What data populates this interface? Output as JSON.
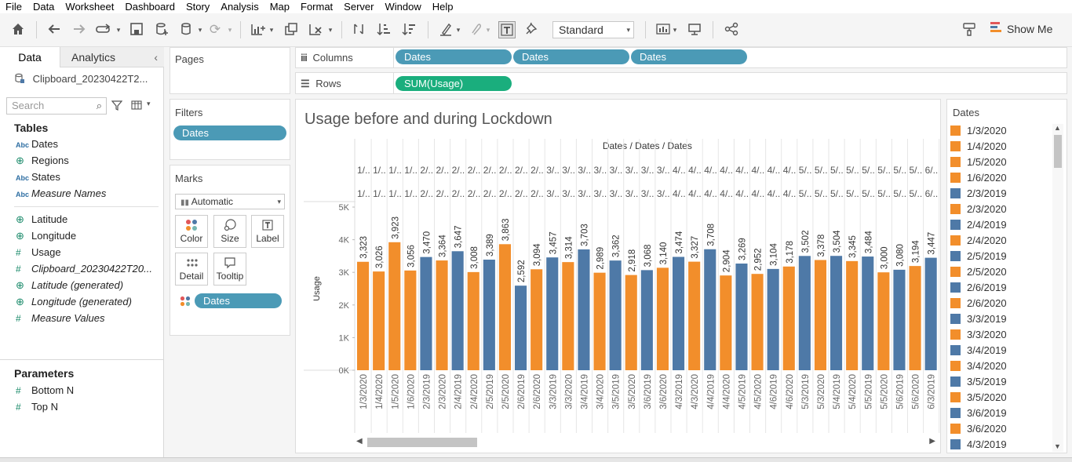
{
  "menu": [
    "File",
    "Data",
    "Worksheet",
    "Dashboard",
    "Story",
    "Analysis",
    "Map",
    "Format",
    "Server",
    "Window",
    "Help"
  ],
  "toolbar": {
    "fit": "Standard",
    "show_me": "Show Me"
  },
  "datapane": {
    "tab_data": "Data",
    "tab_analytics": "Analytics",
    "datasource": "Clipboard_20230422T2...",
    "search_placeholder": "Search",
    "tables_title": "Tables",
    "fields": [
      {
        "label": "Dates",
        "icon": "Abc",
        "italic": false
      },
      {
        "label": "Regions",
        "icon": "globe",
        "italic": false
      },
      {
        "label": "States",
        "icon": "Abc",
        "italic": false
      },
      {
        "label": "Measure Names",
        "icon": "Abc",
        "italic": true
      },
      {
        "label": "Latitude",
        "icon": "globe",
        "italic": false
      },
      {
        "label": "Longitude",
        "icon": "globe",
        "italic": false
      },
      {
        "label": "Usage",
        "icon": "#",
        "italic": false
      },
      {
        "label": "Clipboard_20230422T20...",
        "icon": "#",
        "italic": true
      },
      {
        "label": "Latitude (generated)",
        "icon": "globe",
        "italic": true
      },
      {
        "label": "Longitude (generated)",
        "icon": "globe",
        "italic": true
      },
      {
        "label": "Measure Values",
        "icon": "#",
        "italic": true
      }
    ],
    "parameters_title": "Parameters",
    "parameters": [
      {
        "label": "Bottom N",
        "icon": "#"
      },
      {
        "label": "Top N",
        "icon": "#"
      }
    ]
  },
  "shelves": {
    "pages_title": "Pages",
    "filters_title": "Filters",
    "filter_pill": "Dates",
    "marks_title": "Marks",
    "mark_type": "Automatic",
    "mark_buttons": [
      "Color",
      "Size",
      "Label",
      "Detail",
      "Tooltip"
    ],
    "mark_pill": "Dates",
    "columns_label": "Columns",
    "columns_pills": [
      "Dates",
      "Dates",
      "Dates"
    ],
    "rows_label": "Rows",
    "rows_pill": "SUM(Usage)"
  },
  "chart_title": "Usage before and during Lockdown",
  "chart_data": {
    "type": "bar",
    "header_title": "Dates / Dates / Dates",
    "ylabel": "Usage",
    "ylim": [
      0,
      5000
    ],
    "yticks": [
      "0K",
      "1K",
      "2K",
      "3K",
      "4K",
      "5K"
    ],
    "header_row1": [
      "1/..",
      "1/..",
      "1/..",
      "1/..",
      "2/..",
      "2/..",
      "2/..",
      "2/..",
      "2/..",
      "2/..",
      "2/..",
      "2/..",
      "3/..",
      "3/..",
      "3/..",
      "3/..",
      "3/..",
      "3/..",
      "3/..",
      "3/..",
      "4/..",
      "4/..",
      "4/..",
      "4/..",
      "4/..",
      "4/..",
      "4/..",
      "4/..",
      "5/..",
      "5/..",
      "5/..",
      "5/..",
      "5/..",
      "5/..",
      "5/..",
      "5/..",
      "6/.."
    ],
    "header_row2": [
      "1/..",
      "1/..",
      "1/..",
      "1/..",
      "2/..",
      "2/..",
      "2/..",
      "2/..",
      "2/..",
      "2/..",
      "2/..",
      "2/..",
      "3/..",
      "3/..",
      "3/..",
      "3/..",
      "3/..",
      "3/..",
      "3/..",
      "3/..",
      "4/..",
      "4/..",
      "4/..",
      "4/..",
      "4/..",
      "4/..",
      "4/..",
      "4/..",
      "5/..",
      "5/..",
      "5/..",
      "5/..",
      "5/..",
      "5/..",
      "5/..",
      "5/..",
      "6/.."
    ],
    "categories": [
      "1/3/2020",
      "1/4/2020",
      "1/5/2020",
      "1/6/2020",
      "2/3/2019",
      "2/3/2020",
      "2/4/2019",
      "2/4/2020",
      "2/5/2019",
      "2/5/2020",
      "2/6/2019",
      "2/6/2020",
      "3/3/2019",
      "3/3/2020",
      "3/4/2019",
      "3/4/2020",
      "3/5/2019",
      "3/5/2020",
      "3/6/2019",
      "3/6/2020",
      "4/3/2019",
      "4/3/2020",
      "4/4/2019",
      "4/4/2020",
      "4/5/2019",
      "4/5/2020",
      "4/6/2019",
      "4/6/2020",
      "5/3/2019",
      "5/3/2020",
      "5/4/2019",
      "5/4/2020",
      "5/5/2019",
      "5/5/2020",
      "5/6/2019",
      "5/6/2020",
      "6/3/2019"
    ],
    "values": [
      3323,
      3026,
      3923,
      3056,
      3470,
      3364,
      3647,
      3008,
      3389,
      3863,
      2592,
      3094,
      3457,
      3314,
      3703,
      2989,
      3362,
      2918,
      3068,
      3140,
      3474,
      3327,
      3708,
      2904,
      3269,
      2952,
      3104,
      3178,
      3502,
      3378,
      3504,
      3345,
      3484,
      3000,
      3080,
      3194,
      3447
    ],
    "labels": [
      "3,323",
      "3,026",
      "3,923",
      "3,056",
      "3,470",
      "3,364",
      "3,647",
      "3,008",
      "3,389",
      "3,863",
      "2,592",
      "3,094",
      "3,457",
      "3,314",
      "3,703",
      "2,989",
      "3,362",
      "2,918",
      "3,068",
      "3,140",
      "3,474",
      "3,327",
      "3,708",
      "2,904",
      "3,269",
      "2,952",
      "3,104",
      "3,178",
      "3,502",
      "3,378",
      "3,504",
      "3,345",
      "3,484",
      "3,000",
      "3,080",
      "3,194",
      "3,447"
    ],
    "colors": {
      "2020": "#f28e2b",
      "2019": "#4e79a7"
    }
  },
  "legend": {
    "title": "Dates",
    "items": [
      {
        "label": "1/3/2020",
        "year": "2020"
      },
      {
        "label": "1/4/2020",
        "year": "2020"
      },
      {
        "label": "1/5/2020",
        "year": "2020"
      },
      {
        "label": "1/6/2020",
        "year": "2020"
      },
      {
        "label": "2/3/2019",
        "year": "2019"
      },
      {
        "label": "2/3/2020",
        "year": "2020"
      },
      {
        "label": "2/4/2019",
        "year": "2019"
      },
      {
        "label": "2/4/2020",
        "year": "2020"
      },
      {
        "label": "2/5/2019",
        "year": "2019"
      },
      {
        "label": "2/5/2020",
        "year": "2020"
      },
      {
        "label": "2/6/2019",
        "year": "2019"
      },
      {
        "label": "2/6/2020",
        "year": "2020"
      },
      {
        "label": "3/3/2019",
        "year": "2019"
      },
      {
        "label": "3/3/2020",
        "year": "2020"
      },
      {
        "label": "3/4/2019",
        "year": "2019"
      },
      {
        "label": "3/4/2020",
        "year": "2020"
      },
      {
        "label": "3/5/2019",
        "year": "2019"
      },
      {
        "label": "3/5/2020",
        "year": "2020"
      },
      {
        "label": "3/6/2019",
        "year": "2019"
      },
      {
        "label": "3/6/2020",
        "year": "2020"
      },
      {
        "label": "4/3/2019",
        "year": "2019"
      }
    ]
  }
}
